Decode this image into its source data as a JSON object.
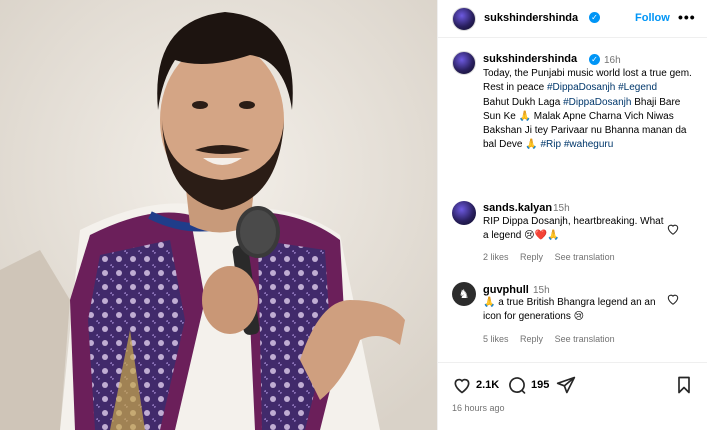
{
  "post": {
    "username": "sukshindershinda",
    "follow_label": "Follow",
    "more_label": "•••",
    "caption_time": "16h",
    "caption_line1": "Today, the Punjabi music world  lost a true gem. Rest in peace",
    "caption_tag1": "#DippaDosanjh",
    "caption_tag2": "#Legend",
    "caption_line2a": "Bahut Dukh Laga",
    "caption_tag3": "#DippaDosanjh",
    "caption_line2b": "Bhaji Bare Sun Ke 🙏 Malak Apne Charna Vich Niwas Bakshan Ji tey Parivaar nu Bhanna manan da bal Deve 🙏",
    "caption_tag4": "#Rip",
    "caption_tag5": "#waheguru"
  },
  "comments": [
    {
      "username": "sands.kalyan",
      "time": "15h",
      "text": "RIP Dippa Dosanjh, heartbreaking. What a legend 😢❤️🙏",
      "likes": "2 likes",
      "reply": "Reply",
      "translation": "See translation"
    },
    {
      "username": "guvphull",
      "time": "15h",
      "text": "🙏 a true British Bhangra legend an an icon for generations 😢",
      "likes": "5 likes",
      "reply": "Reply",
      "translation": "See translation"
    }
  ],
  "actions": {
    "like_count": "2.1K",
    "comment_count": "195",
    "posted_ago": "16 hours ago"
  },
  "icons": {
    "like": "heart-icon",
    "comment": "comment-icon",
    "share": "share-icon",
    "save": "bookmark-icon",
    "verified": "verified-badge-icon",
    "more": "more-options-icon"
  }
}
